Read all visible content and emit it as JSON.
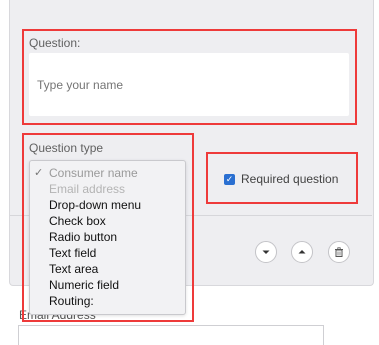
{
  "question": {
    "label": "Question:",
    "placeholder": "Type your name"
  },
  "question_type": {
    "label": "Question type",
    "options": [
      {
        "label": "Consumer name",
        "state": "selected"
      },
      {
        "label": "Email address",
        "state": "disabled"
      },
      {
        "label": "Drop-down menu",
        "state": "enabled"
      },
      {
        "label": "Check box",
        "state": "enabled"
      },
      {
        "label": "Radio button",
        "state": "enabled"
      },
      {
        "label": "Text field",
        "state": "enabled"
      },
      {
        "label": "Text area",
        "state": "enabled"
      },
      {
        "label": "Numeric field",
        "state": "enabled"
      },
      {
        "label": "Routing:",
        "state": "enabled"
      }
    ],
    "selected_mark": "✓"
  },
  "required": {
    "label": "Required question",
    "checked": true
  },
  "actions": {
    "move_down_icon": "chevron-down-icon",
    "move_up_icon": "chevron-up-icon",
    "delete_icon": "trash-icon"
  },
  "next_field": {
    "label": "Email Address"
  },
  "colors": {
    "highlight": "#ee3a3a",
    "checkbox": "#2a6fd1",
    "card_background": "#eeeef1"
  }
}
